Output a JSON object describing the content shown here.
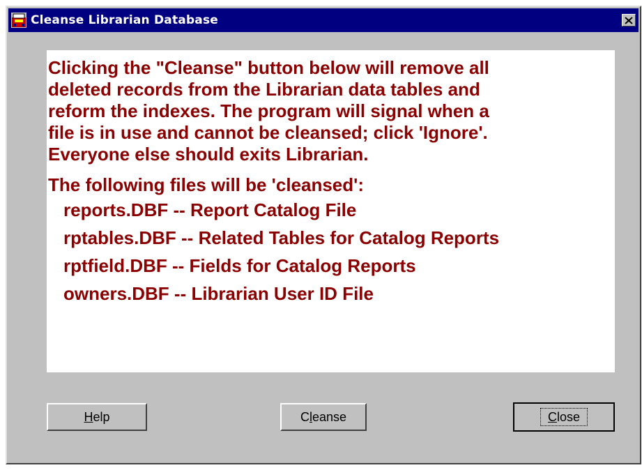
{
  "window": {
    "title": "Cleanse Librarian Database",
    "icon": "librarian-app-icon",
    "close_glyph": "×"
  },
  "message": {
    "intro": [
      "Clicking the \"Cleanse\" button below will remove all",
      "deleted records from the Librarian data tables and",
      "reform the indexes. The program will signal when a",
      "file is in use and cannot be cleansed; click 'Ignore'.",
      "Everyone else should exits Librarian."
    ],
    "files_heading": "The following files will be 'cleansed':",
    "files": [
      "reports.DBF -- Report Catalog File",
      "rptables.DBF -- Related Tables for Catalog Reports",
      "rptfield.DBF -- Fields for Catalog Reports",
      "owners.DBF -- Librarian User ID File"
    ]
  },
  "buttons": {
    "help": {
      "mnemonic": "H",
      "rest": "elp"
    },
    "cleanse": {
      "before": "C",
      "mnemonic": "l",
      "rest": "eanse"
    },
    "close": {
      "mnemonic": "C",
      "rest": "lose"
    }
  },
  "colors": {
    "title_bar": "#000080",
    "message_text": "#8b0000",
    "dialog_face": "#c0c0c0"
  }
}
